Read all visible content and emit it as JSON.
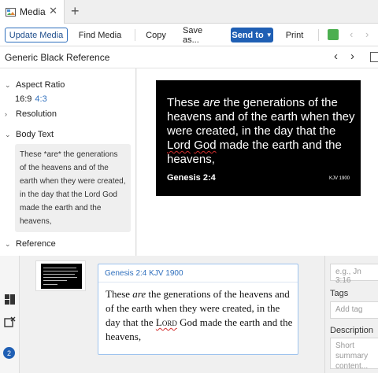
{
  "tab": {
    "label": "Media"
  },
  "toolbar": {
    "update_media": "Update Media",
    "find_media": "Find Media",
    "copy": "Copy",
    "save_as": "Save as...",
    "send_to": "Send to",
    "print": "Print"
  },
  "title": "Generic Black Reference",
  "settings": {
    "aspect_ratio": {
      "label": "Aspect Ratio",
      "selected": "16:9",
      "option": "4:3"
    },
    "resolution": {
      "label": "Resolution"
    },
    "body_text": {
      "label": "Body Text",
      "value": "These *are* the generations of the heavens and of the earth when they were created, in the day that the Lord God made the earth and the heavens,"
    },
    "reference": {
      "label": "Reference"
    }
  },
  "slide": {
    "text_1": "These ",
    "text_em": "are",
    "text_2": " the generations of the heavens and of the earth when they were created, in the day that the ",
    "text_lord": "Lord",
    "text_god": "God",
    "text_3": " made the earth and the heavens,",
    "reference": "Genesis 2:4",
    "version": "KJV 1900"
  },
  "card": {
    "reference": "Genesis 2:4 KJV 1900",
    "text_1": "These ",
    "text_em": "are",
    "text_2": " the generations of the heavens and of the earth when they were created, in the day that the ",
    "text_lord": "Lord",
    "text_3": " God made the earth and the heavens,"
  },
  "right_panel": {
    "passages_placeholder": "e.g., Jn 3:16",
    "tags_label": "Tags",
    "tags_placeholder": "Add tag",
    "description_label": "Description",
    "description_placeholder": "Short summary content..."
  },
  "rail": {
    "badge": "2"
  },
  "colors": {
    "accent": "#1f5fb4",
    "link": "#2f6fbd",
    "slide_bg": "#000000",
    "spellcheck": "#d32f2f"
  }
}
